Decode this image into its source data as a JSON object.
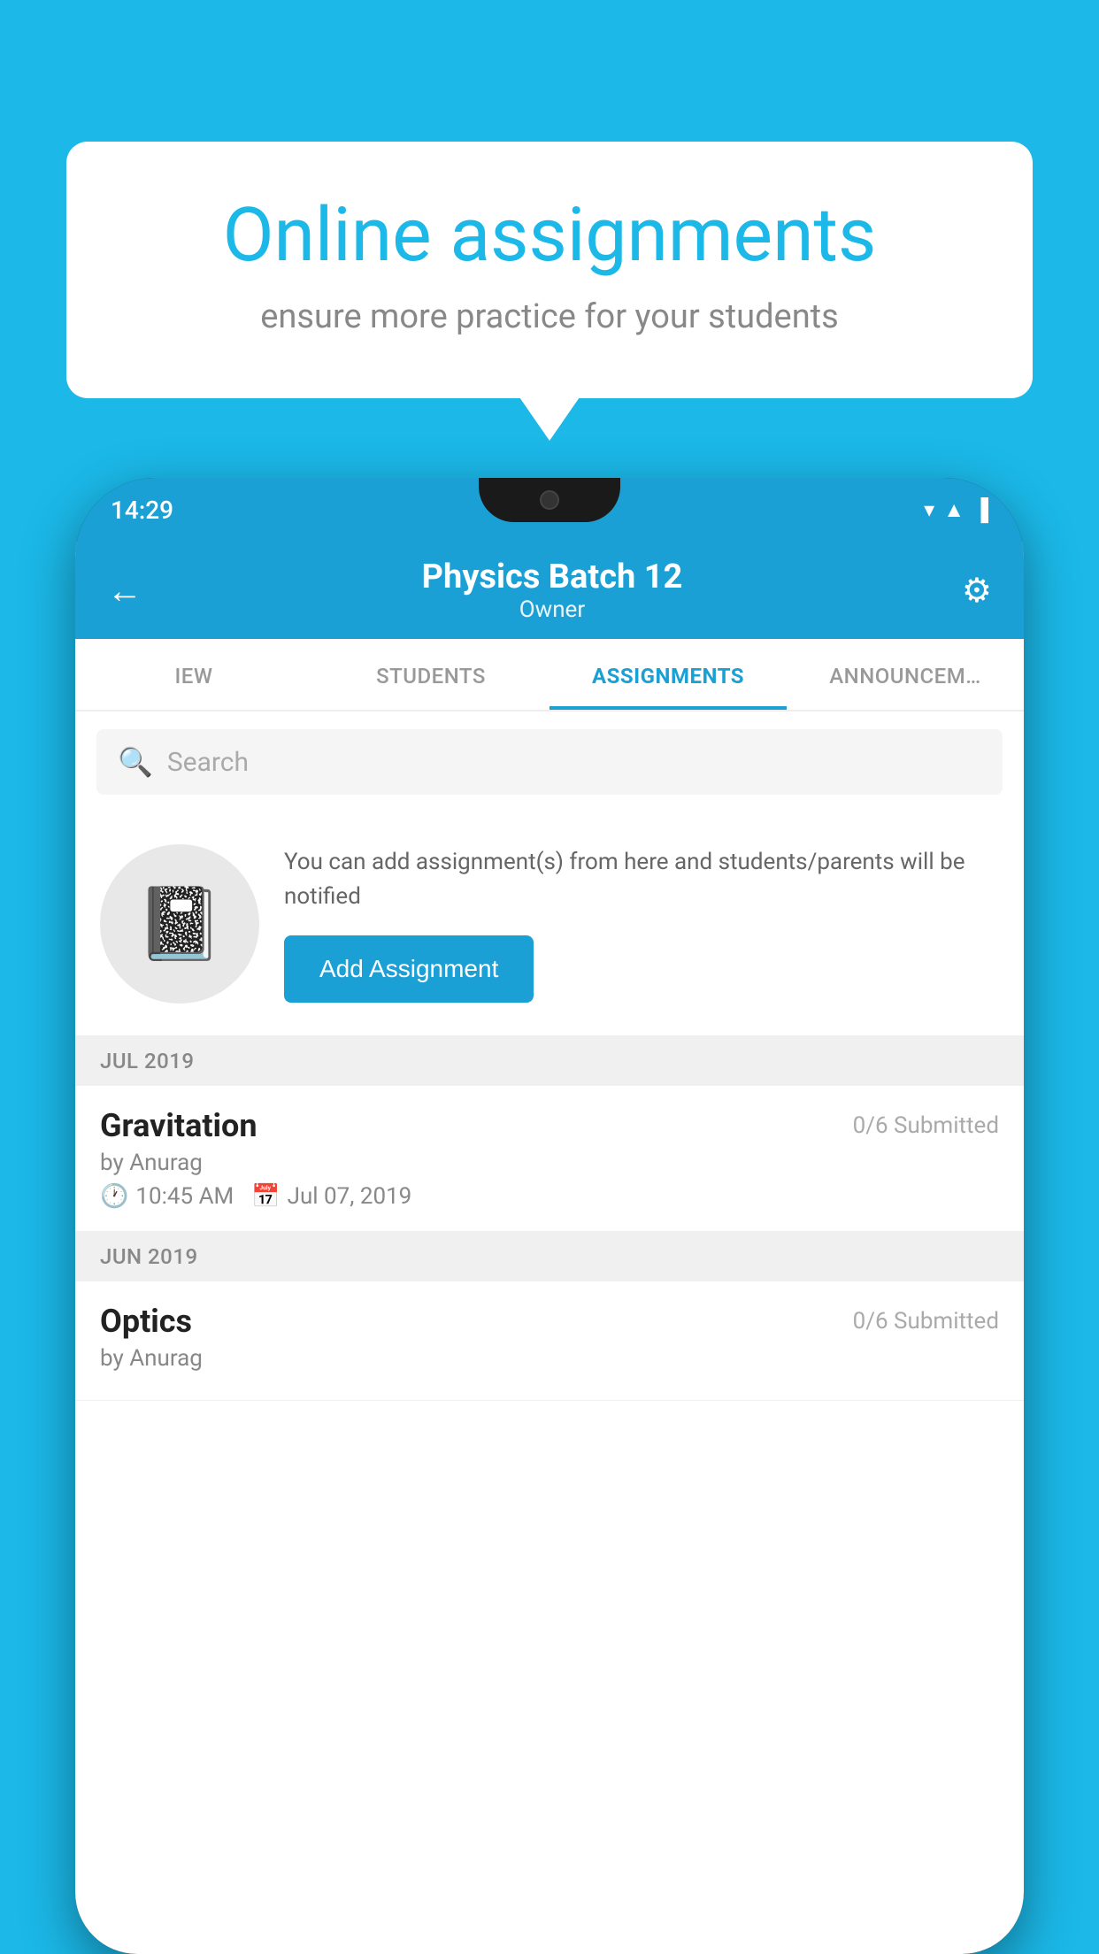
{
  "background_color": "#1BB8E8",
  "bubble": {
    "title": "Online assignments",
    "subtitle": "ensure more practice for your students"
  },
  "status_bar": {
    "time": "14:29",
    "icons": [
      "▼",
      "▲",
      "▐"
    ]
  },
  "header": {
    "title": "Physics Batch 12",
    "subtitle": "Owner",
    "back_label": "←",
    "settings_label": "⚙"
  },
  "tabs": [
    {
      "label": "IEW",
      "active": false
    },
    {
      "label": "STUDENTS",
      "active": false
    },
    {
      "label": "ASSIGNMENTS",
      "active": true
    },
    {
      "label": "ANNOUNCEM…",
      "active": false
    }
  ],
  "search": {
    "placeholder": "Search"
  },
  "add_assignment": {
    "description": "You can add assignment(s) from here and students/parents will be notified",
    "button_label": "Add Assignment"
  },
  "sections": [
    {
      "label": "JUL 2019",
      "items": [
        {
          "name": "Gravitation",
          "submitted": "0/6 Submitted",
          "by": "by Anurag",
          "time": "10:45 AM",
          "date": "Jul 07, 2019"
        }
      ]
    },
    {
      "label": "JUN 2019",
      "items": [
        {
          "name": "Optics",
          "submitted": "0/6 Submitted",
          "by": "by Anurag",
          "time": "",
          "date": ""
        }
      ]
    }
  ]
}
